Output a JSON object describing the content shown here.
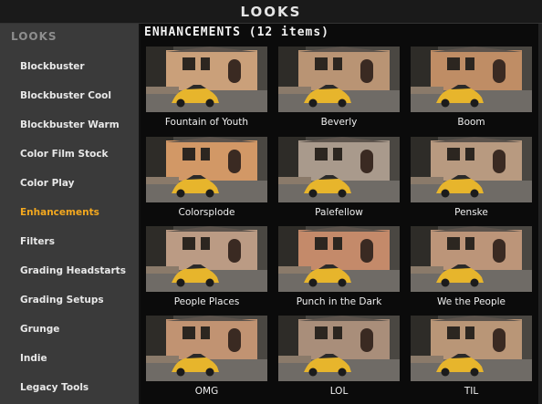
{
  "window": {
    "title": "LOOKS"
  },
  "sidebar": {
    "header": "LOOKS",
    "items": [
      {
        "label": "Blockbuster",
        "active": false
      },
      {
        "label": "Blockbuster Cool",
        "active": false
      },
      {
        "label": "Blockbuster Warm",
        "active": false
      },
      {
        "label": "Color Film Stock",
        "active": false
      },
      {
        "label": "Color Play",
        "active": false
      },
      {
        "label": "Enhancements",
        "active": true
      },
      {
        "label": "Filters",
        "active": false
      },
      {
        "label": "Grading Headstarts",
        "active": false
      },
      {
        "label": "Grading Setups",
        "active": false
      },
      {
        "label": "Grunge",
        "active": false
      },
      {
        "label": "Indie",
        "active": false
      },
      {
        "label": "Legacy Tools",
        "active": false
      }
    ]
  },
  "main": {
    "section_title": "ENHANCEMENTS (12 items)",
    "looks": [
      {
        "label": "Fountain of Youth",
        "tone": "#caa07a"
      },
      {
        "label": "Beverly",
        "tone": "#b99474"
      },
      {
        "label": "Boom",
        "tone": "#bf8d65"
      },
      {
        "label": "Colorsplode",
        "tone": "#d29866"
      },
      {
        "label": "Palefellow",
        "tone": "#a99a8c"
      },
      {
        "label": "Penske",
        "tone": "#b89a80"
      },
      {
        "label": "People Places",
        "tone": "#bb9b84"
      },
      {
        "label": "Punch in the Dark",
        "tone": "#c48a6a"
      },
      {
        "label": "We the People",
        "tone": "#bc9579"
      },
      {
        "label": "OMG",
        "tone": "#c19372"
      },
      {
        "label": "LOL",
        "tone": "#a98e7a"
      },
      {
        "label": "TIL",
        "tone": "#b99677"
      }
    ]
  },
  "colors": {
    "accent": "#f3a81f",
    "sidebar_bg": "#3a3a3a",
    "main_bg": "#0b0b0b"
  }
}
